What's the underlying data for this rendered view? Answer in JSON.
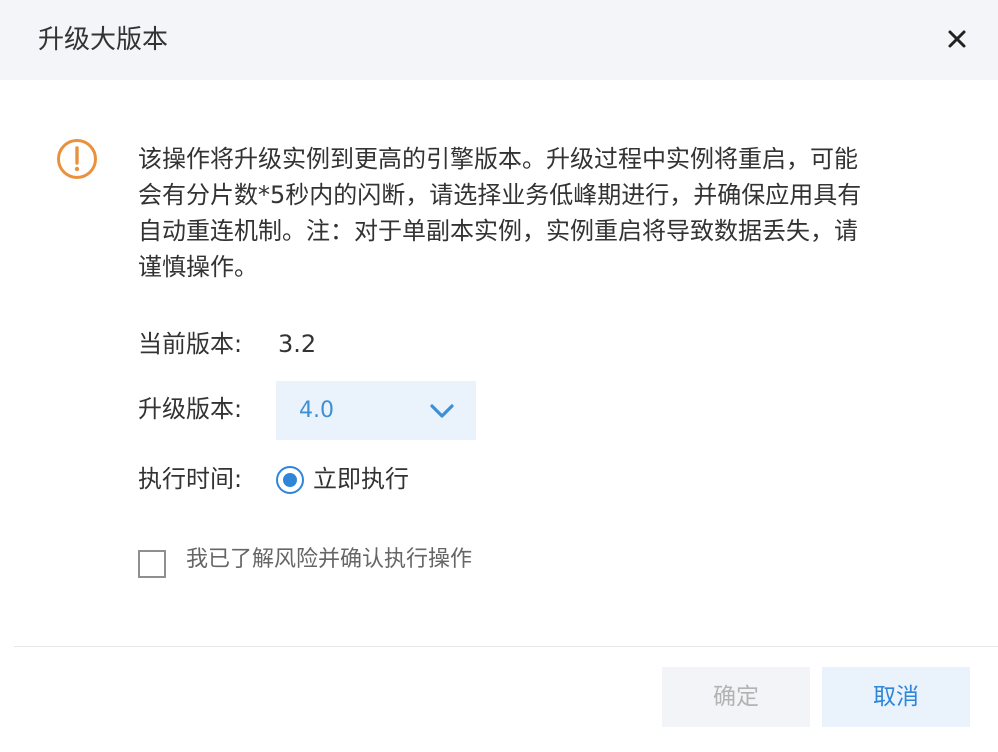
{
  "dialog": {
    "title": "升级大版本",
    "close_icon": "close-icon"
  },
  "warning": {
    "icon": "exclamation-circle-icon",
    "icon_color": "#E9913D",
    "message": "该操作将升级实例到更高的引擎版本。升级过程中实例将重启，可能\n会有分片数*5秒内的闪断，请选择业务低峰期进行，并确保应用具有\n自动重连机制。注：对于单副本实例，实例重启将导致数据丢失，请\n谨慎操作。"
  },
  "form": {
    "current_version_label": "当前版本:",
    "current_version_value": "3.2",
    "upgrade_version_label": "升级版本:",
    "upgrade_version_value": "4.0",
    "upgrade_version_icon": "chevron-down-icon",
    "exec_time_label": "执行时间:",
    "exec_time_option": "立即执行",
    "exec_time_selected": true
  },
  "acknowledge": {
    "label": "我已了解风险并确认执行操作",
    "checked": false
  },
  "footer": {
    "confirm_label": "确定",
    "cancel_label": "取消"
  },
  "colors": {
    "accent": "#2F86D9",
    "warning": "#E9913D",
    "header_bg": "#F3F5F8",
    "select_bg": "#EAF3FB"
  }
}
